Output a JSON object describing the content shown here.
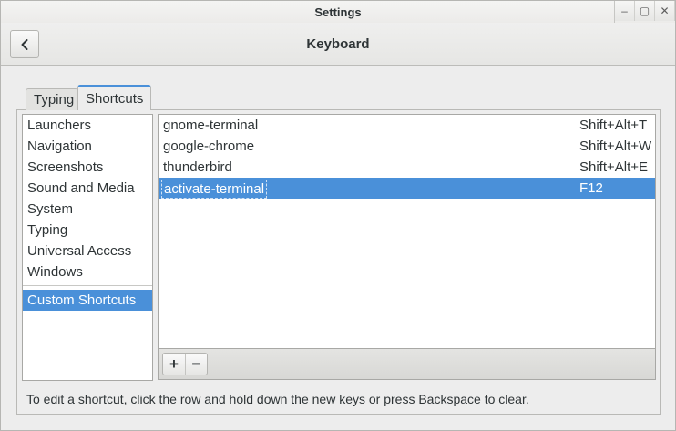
{
  "window": {
    "title": "Settings",
    "buttons": [
      {
        "name": "minimize",
        "glyph": "–"
      },
      {
        "name": "maximize",
        "glyph": "▢"
      },
      {
        "name": "close",
        "glyph": "✕"
      }
    ]
  },
  "header": {
    "back_icon": "chevron-left-icon",
    "title": "Keyboard"
  },
  "tabs": [
    {
      "label": "Typing",
      "active": false
    },
    {
      "label": "Shortcuts",
      "active": true
    }
  ],
  "sections": {
    "items": [
      "Launchers",
      "Navigation",
      "Screenshots",
      "Sound and Media",
      "System",
      "Typing",
      "Universal Access",
      "Windows"
    ],
    "custom": "Custom Shortcuts",
    "selected": "Custom Shortcuts"
  },
  "shortcuts": {
    "rows": [
      {
        "name": "gnome-terminal",
        "accel": "Shift+Alt+T",
        "selected": false
      },
      {
        "name": "google-chrome",
        "accel": "Shift+Alt+W",
        "selected": false
      },
      {
        "name": "thunderbird",
        "accel": "Shift+Alt+E",
        "selected": false
      },
      {
        "name": "activate-terminal",
        "accel": "F12",
        "selected": true
      }
    ]
  },
  "toolbar": {
    "add_label": "+",
    "remove_label": "−"
  },
  "hint": "To edit a shortcut, click the row and hold down the new keys or press Backspace to clear.",
  "colors": {
    "accent": "#4a90d9",
    "background": "#ededed"
  }
}
